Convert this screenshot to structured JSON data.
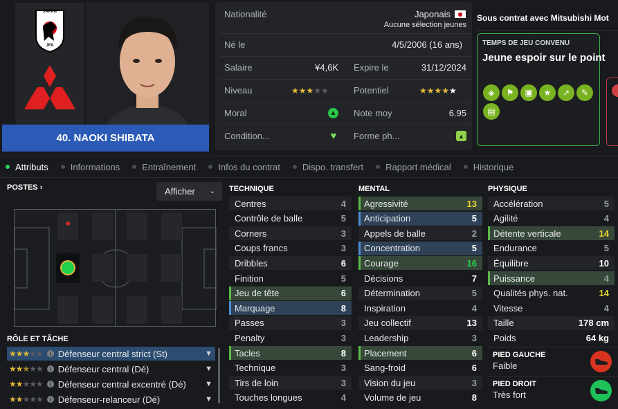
{
  "player": {
    "name_line": "40. NAOKI SHIBATA",
    "flag_caption": "JAPAN"
  },
  "info": {
    "nationality_label": "Nationalité",
    "nationality_value": "Japonais",
    "selection_note": "Aucune sélection jeunes",
    "born_label": "Né le",
    "born_value": "4/5/2006 (16 ans)",
    "salary_label": "Salaire",
    "salary_value": "¥4,6K",
    "expires_label": "Expire le",
    "expires_value": "31/12/2024",
    "level_label": "Niveau",
    "potential_label": "Potentiel",
    "morale_label": "Moral",
    "avg_rating_label": "Note moy",
    "avg_rating_value": "6.95",
    "condition_label": "Condition...",
    "form_label": "Forme ph..."
  },
  "ratings": {
    "level_stars": 3,
    "level_max": 5,
    "potential_stars": 4.5,
    "potential_max": 5
  },
  "contract": {
    "header": "Sous contrat avec Mitsubishi Mot",
    "playing_time_label": "TEMPS DE JEU CONVENU",
    "playing_time_value": "Jeune espoir sur le point",
    "badge_icons": [
      "defender-shield-icon",
      "tackle-icon",
      "card-icon",
      "star-icon",
      "trend-up-icon",
      "pencil-icon",
      "team-icon"
    ]
  },
  "tabs": [
    "Attributs",
    "Informations",
    "Entraînement",
    "Infos du contrat",
    "Dispo. transfert",
    "Rapport médical",
    "Historique"
  ],
  "positions": {
    "label": "POSTES",
    "display_button": "Afficher"
  },
  "roles": {
    "label": "RÔLE ET TÂCHE",
    "items": [
      {
        "name": "Défenseur central strict (St)",
        "stars": 3
      },
      {
        "name": "Défenseur central (Dé)",
        "stars": 2.5
      },
      {
        "name": "Défenseur central excentré (Dé)",
        "stars": 2
      },
      {
        "name": "Défenseur-relanceur (Dé)",
        "stars": 2
      }
    ]
  },
  "technique": {
    "label": "TECHNIQUE",
    "rows": [
      {
        "name": "Centres",
        "value": "4"
      },
      {
        "name": "Contrôle de balle",
        "value": "5"
      },
      {
        "name": "Corners",
        "value": "3"
      },
      {
        "name": "Coups francs",
        "value": "3"
      },
      {
        "name": "Dribbles",
        "value": "6"
      },
      {
        "name": "Finition",
        "value": "5"
      },
      {
        "name": "Jeu de tête",
        "value": "6"
      },
      {
        "name": "Marquage",
        "value": "8"
      },
      {
        "name": "Passes",
        "value": "3"
      },
      {
        "name": "Penalty",
        "value": "3"
      },
      {
        "name": "Tacles",
        "value": "8"
      },
      {
        "name": "Technique",
        "value": "3"
      },
      {
        "name": "Tirs de loin",
        "value": "3"
      },
      {
        "name": "Touches longues",
        "value": "4"
      }
    ]
  },
  "mental": {
    "label": "MENTAL",
    "rows": [
      {
        "name": "Agressivité",
        "value": "13"
      },
      {
        "name": "Anticipation",
        "value": "5"
      },
      {
        "name": "Appels de balle",
        "value": "2"
      },
      {
        "name": "Concentration",
        "value": "5"
      },
      {
        "name": "Courage",
        "value": "16"
      },
      {
        "name": "Décisions",
        "value": "7"
      },
      {
        "name": "Détermination",
        "value": "5"
      },
      {
        "name": "Inspiration",
        "value": "4"
      },
      {
        "name": "Jeu collectif",
        "value": "13"
      },
      {
        "name": "Leadership",
        "value": "3"
      },
      {
        "name": "Placement",
        "value": "6"
      },
      {
        "name": "Sang-froid",
        "value": "6"
      },
      {
        "name": "Vision du jeu",
        "value": "3"
      },
      {
        "name": "Volume de jeu",
        "value": "8"
      }
    ]
  },
  "physique": {
    "label": "PHYSIQUE",
    "rows": [
      {
        "name": "Accélération",
        "value": "5"
      },
      {
        "name": "Agilité",
        "value": "4"
      },
      {
        "name": "Détente verticale",
        "value": "14"
      },
      {
        "name": "Endurance",
        "value": "5"
      },
      {
        "name": "Équilibre",
        "value": "10"
      },
      {
        "name": "Puissance",
        "value": "4"
      },
      {
        "name": "Qualités phys. nat.",
        "value": "14"
      },
      {
        "name": "Vitesse",
        "value": "4"
      },
      {
        "name": "Taille",
        "value": "178 cm"
      },
      {
        "name": "Poids",
        "value": "64 kg"
      }
    ]
  },
  "feet": {
    "left_label": "PIED GAUCHE",
    "left_value": "Faible",
    "right_label": "PIED DROIT",
    "right_value": "Très fort"
  },
  "colors": {
    "accent_blue": "#2c5bb7",
    "highlight_green": "#37483a",
    "highlight_blue": "#2f4257",
    "rating_yellow": "#e6d22a",
    "rating_green": "#29d14e"
  }
}
